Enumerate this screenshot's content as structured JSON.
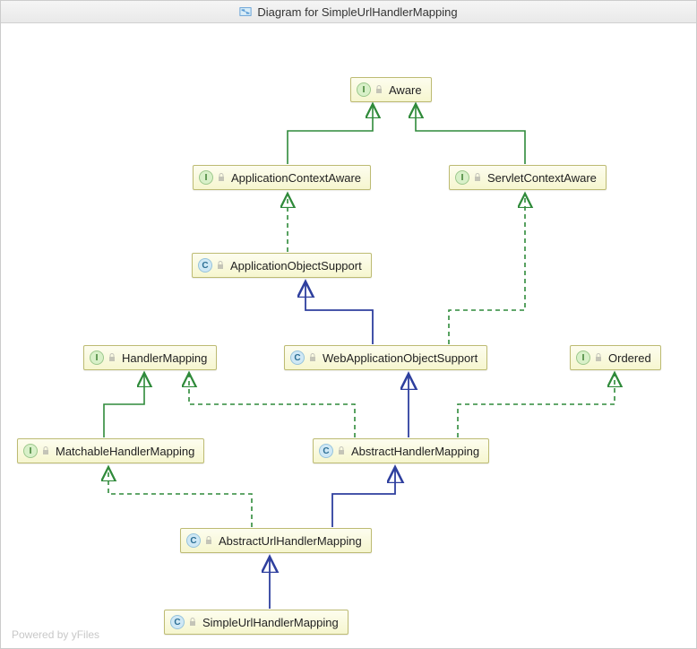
{
  "title": "Diagram for SimpleUrlHandlerMapping",
  "footer": "Powered by yFiles",
  "colors": {
    "extends_edge": "#2e3f9e",
    "implements_edge": "#2f8a3a",
    "node_fill_top": "#fdfdef",
    "node_fill_bottom": "#f6f6cf",
    "node_border": "#bdbb73"
  },
  "nodes": {
    "aware": {
      "label": "Aware",
      "kind": "I"
    },
    "appCtxAware": {
      "label": "ApplicationContextAware",
      "kind": "I"
    },
    "servletCtxAware": {
      "label": "ServletContextAware",
      "kind": "I"
    },
    "appObjSupport": {
      "label": "ApplicationObjectSupport",
      "kind": "C"
    },
    "handlerMapping": {
      "label": "HandlerMapping",
      "kind": "I"
    },
    "webAppObjSupport": {
      "label": "WebApplicationObjectSupport",
      "kind": "C"
    },
    "ordered": {
      "label": "Ordered",
      "kind": "I"
    },
    "matchableHM": {
      "label": "MatchableHandlerMapping",
      "kind": "I"
    },
    "abstractHM": {
      "label": "AbstractHandlerMapping",
      "kind": "C"
    },
    "abstractUrlHM": {
      "label": "AbstractUrlHandlerMapping",
      "kind": "C"
    },
    "simpleUrlHM": {
      "label": "SimpleUrlHandlerMapping",
      "kind": "C"
    }
  },
  "edges": [
    {
      "from": "appCtxAware",
      "to": "aware",
      "type": "implements"
    },
    {
      "from": "servletCtxAware",
      "to": "aware",
      "type": "implements"
    },
    {
      "from": "appObjSupport",
      "to": "appCtxAware",
      "type": "implements"
    },
    {
      "from": "webAppObjSupport",
      "to": "appObjSupport",
      "type": "extends"
    },
    {
      "from": "webAppObjSupport",
      "to": "servletCtxAware",
      "type": "implements"
    },
    {
      "from": "matchableHM",
      "to": "handlerMapping",
      "type": "implements"
    },
    {
      "from": "abstractHM",
      "to": "webAppObjSupport",
      "type": "extends"
    },
    {
      "from": "abstractHM",
      "to": "handlerMapping",
      "type": "implements"
    },
    {
      "from": "abstractHM",
      "to": "ordered",
      "type": "implements"
    },
    {
      "from": "abstractUrlHM",
      "to": "abstractHM",
      "type": "extends"
    },
    {
      "from": "abstractUrlHM",
      "to": "matchableHM",
      "type": "implements"
    },
    {
      "from": "simpleUrlHM",
      "to": "abstractUrlHM",
      "type": "extends"
    }
  ]
}
